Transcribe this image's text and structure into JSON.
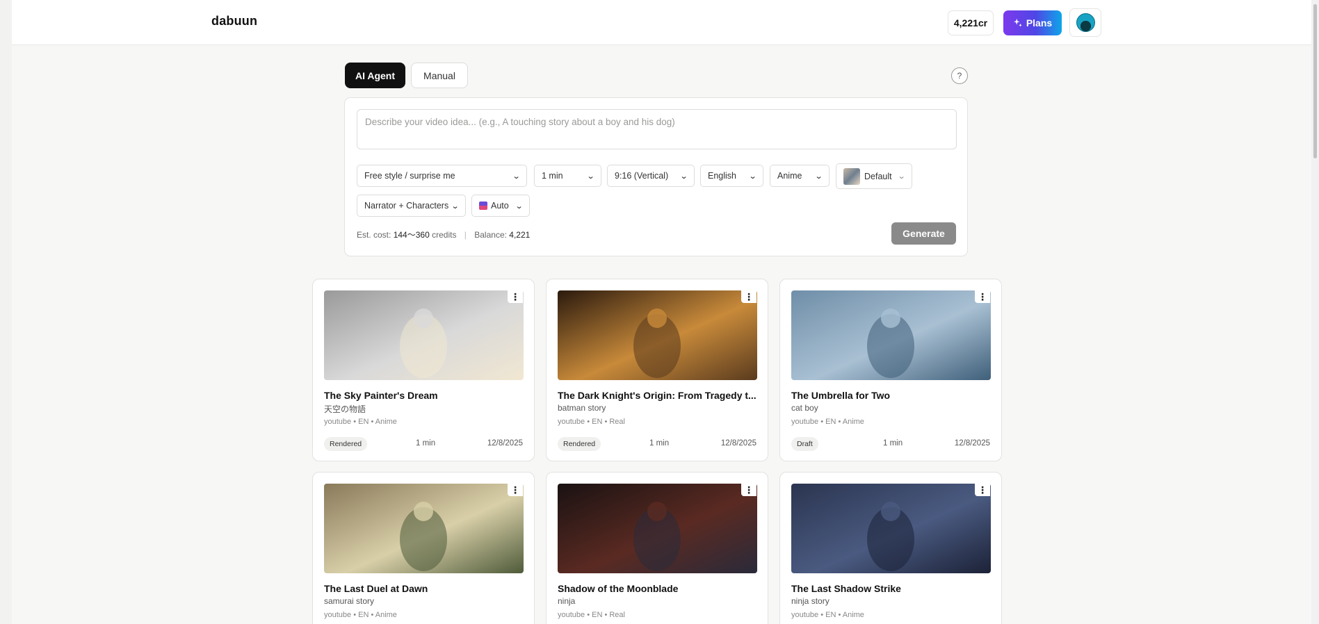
{
  "app": {
    "logo": "dabuun"
  },
  "header": {
    "credits": "4,221cr",
    "plans_label": "Plans"
  },
  "modes": {
    "agent": "AI Agent",
    "manual": "Manual"
  },
  "composer": {
    "placeholder": "Describe your video idea... (e.g., A touching story about a boy and his dog)",
    "style": "Free style / surprise me",
    "duration": "1 min",
    "aspect": "9:16 (Vertical)",
    "language": "English",
    "visual": "Anime",
    "voice": "Default",
    "cast": "Narrator + Characters",
    "model": "Auto",
    "cost_label": "Est. cost:",
    "cost_value": "144〜360",
    "cost_unit": "credits",
    "balance_label": "Balance:",
    "balance_value": "4,221",
    "generate_label": "Generate"
  },
  "projects": [
    {
      "title": "The Sky Painter's Dream",
      "subtitle": "天空の物語",
      "meta": "youtube • EN • Anime",
      "status": "Rendered",
      "duration": "1 min",
      "date": "12/8/2025",
      "colors": [
        "#9a9a9a",
        "#d9d9d9",
        "#f1e7d2"
      ]
    },
    {
      "title": "The Dark Knight's Origin: From Tragedy t...",
      "subtitle": "batman story",
      "meta": "youtube • EN • Real",
      "status": "Rendered",
      "duration": "1 min",
      "date": "12/8/2025",
      "colors": [
        "#2b1a0e",
        "#c88a3a",
        "#5a3b1e"
      ]
    },
    {
      "title": "The Umbrella for Two",
      "subtitle": "cat boy",
      "meta": "youtube • EN • Anime",
      "status": "Draft",
      "duration": "1 min",
      "date": "12/8/2025",
      "colors": [
        "#6f8ea8",
        "#a9c0d3",
        "#3f5f7a"
      ]
    },
    {
      "title": "The Last Duel at Dawn",
      "subtitle": "samurai story",
      "meta": "youtube • EN • Anime",
      "colors": [
        "#8a7a5a",
        "#d8cfa8",
        "#4f5b3a"
      ]
    },
    {
      "title": "Shadow of the Moonblade",
      "subtitle": "ninja",
      "meta": "youtube • EN • Real",
      "colors": [
        "#1a1212",
        "#5a2a22",
        "#2a2a3a"
      ]
    },
    {
      "title": "The Last Shadow Strike",
      "subtitle": "ninja story",
      "meta": "youtube • EN • Anime",
      "colors": [
        "#2b3550",
        "#4a5a80",
        "#1c2238"
      ]
    }
  ]
}
